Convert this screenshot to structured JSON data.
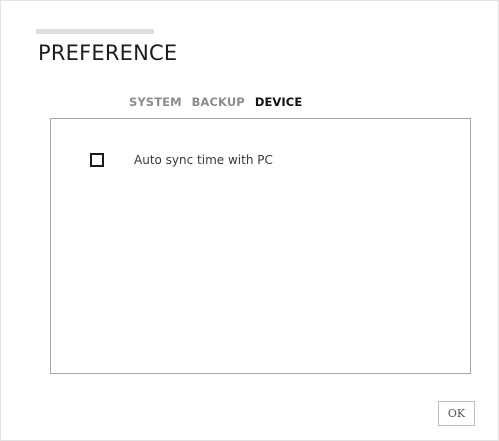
{
  "dialog": {
    "title": "PREFERENCE"
  },
  "tabs": [
    {
      "label": "SYSTEM",
      "active": false
    },
    {
      "label": "BACKUP",
      "active": false
    },
    {
      "label": "DEVICE",
      "active": true
    }
  ],
  "device_panel": {
    "options": [
      {
        "label": "Auto sync time with PC",
        "checked": false
      }
    ]
  },
  "footer": {
    "ok_label": "OK"
  },
  "colors": {
    "active_tab": "#111111",
    "inactive_tab": "#8c8c8c",
    "panel_border": "#a6a6a6"
  }
}
